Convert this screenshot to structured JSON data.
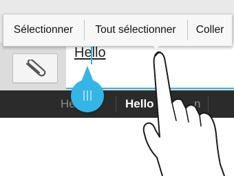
{
  "context_menu": {
    "select_label": "Sélectionner",
    "select_all_label": "Tout sélectionner",
    "paste_label": "Coller"
  },
  "compose": {
    "message_text": "Hello",
    "attach_icon": "paperclip-icon"
  },
  "suggestions": {
    "left": "Hel",
    "center": "Hello",
    "right": "n"
  },
  "colors": {
    "accent": "#33b5e5",
    "suggestion_bar": "#2b2b2b"
  }
}
